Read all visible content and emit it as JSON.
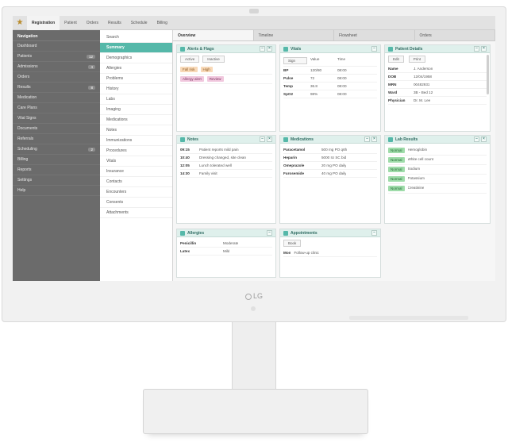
{
  "monitor": {
    "brand": "LG"
  },
  "topbar": {
    "tabs": [
      "Registration",
      "Patient",
      "Orders",
      "Results",
      "Schedule",
      "Billing"
    ]
  },
  "leftnav": {
    "header": "Navigation",
    "items": [
      {
        "label": "Dashboard",
        "badge": ""
      },
      {
        "label": "Patients",
        "badge": "12"
      },
      {
        "label": "Admissions",
        "badge": "4"
      },
      {
        "label": "Orders",
        "badge": ""
      },
      {
        "label": "Results",
        "badge": "8"
      },
      {
        "label": "Medication",
        "badge": ""
      },
      {
        "label": "Care Plans",
        "badge": ""
      },
      {
        "label": "Vital Signs",
        "badge": ""
      },
      {
        "label": "Documents",
        "badge": ""
      },
      {
        "label": "Referrals",
        "badge": ""
      },
      {
        "label": "Scheduling",
        "badge": "2"
      },
      {
        "label": "Billing",
        "badge": ""
      },
      {
        "label": "Reports",
        "badge": ""
      },
      {
        "label": "Settings",
        "badge": ""
      },
      {
        "label": "Help",
        "badge": ""
      }
    ]
  },
  "sublist": {
    "items": [
      {
        "label": "Search",
        "active": false
      },
      {
        "label": "Summary",
        "active": true
      },
      {
        "label": "Demographics",
        "active": false
      },
      {
        "label": "Allergies",
        "active": false
      },
      {
        "label": "Problems",
        "active": false
      },
      {
        "label": "History",
        "active": false
      },
      {
        "label": "Labs",
        "active": false
      },
      {
        "label": "Imaging",
        "active": false
      },
      {
        "label": "Medications",
        "active": false
      },
      {
        "label": "Notes",
        "active": false
      },
      {
        "label": "Immunizations",
        "active": false
      },
      {
        "label": "Procedures",
        "active": false
      },
      {
        "label": "Vitals",
        "active": false
      },
      {
        "label": "Insurance",
        "active": false
      },
      {
        "label": "Contacts",
        "active": false
      },
      {
        "label": "Encounters",
        "active": false
      },
      {
        "label": "Consents",
        "active": false
      },
      {
        "label": "Attachments",
        "active": false
      }
    ]
  },
  "main": {
    "tabs": [
      "Overview",
      "Timeline",
      "Flowsheet",
      "Orders"
    ],
    "panels": {
      "alerts": {
        "title": "Alerts & Flags",
        "buttons": [
          "Active",
          "Inactive"
        ],
        "rows": [
          {
            "name": "Fall risk",
            "status": "High"
          },
          {
            "name": "Allergy alert",
            "status": "Review"
          }
        ]
      },
      "vitals": {
        "title": "Vitals",
        "headers": [
          "Sign",
          "Value",
          "Time"
        ],
        "rows": [
          {
            "sign": "BP",
            "value": "120/80",
            "time": "08:00"
          },
          {
            "sign": "Pulse",
            "value": "72",
            "time": "08:00"
          },
          {
            "sign": "Temp",
            "value": "36.8",
            "time": "08:00"
          },
          {
            "sign": "SpO2",
            "value": "98%",
            "time": "08:00"
          }
        ]
      },
      "patient": {
        "title": "Patient Details",
        "buttons": [
          "Edit",
          "Print"
        ],
        "rows": [
          {
            "label": "Name",
            "value": "J. Anderson"
          },
          {
            "label": "DOB",
            "value": "12/04/1958"
          },
          {
            "label": "MRN",
            "value": "00482931"
          },
          {
            "label": "Ward",
            "value": "3B - Bed 12"
          },
          {
            "label": "Physician",
            "value": "Dr. M. Lee"
          }
        ]
      },
      "notes": {
        "title": "Notes",
        "rows": [
          {
            "time": "09:15",
            "text": "Patient reports mild pain"
          },
          {
            "time": "10:40",
            "text": "Dressing changed, site clean"
          },
          {
            "time": "12:05",
            "text": "Lunch tolerated well"
          },
          {
            "time": "14:30",
            "text": "Family visit"
          }
        ]
      },
      "medications": {
        "title": "Medications",
        "rows": [
          {
            "name": "Paracetamol",
            "dose": "500 mg PO q6h"
          },
          {
            "name": "Heparin",
            "dose": "5000 IU SC bid"
          },
          {
            "name": "Omeprazole",
            "dose": "20 mg PO daily"
          },
          {
            "name": "Furosemide",
            "dose": "40 mg PO daily"
          }
        ]
      },
      "results": {
        "title": "Lab Results",
        "rows": [
          {
            "flag": "Normal",
            "test": "Hemoglobin"
          },
          {
            "flag": "Normal",
            "test": "White cell count"
          },
          {
            "flag": "Normal",
            "test": "Sodium"
          },
          {
            "flag": "Normal",
            "test": "Potassium"
          },
          {
            "flag": "Normal",
            "test": "Creatinine"
          }
        ]
      },
      "allergies": {
        "title": "Allergies",
        "rows": [
          {
            "name": "Penicillin",
            "severity": "Moderate"
          },
          {
            "name": "Latex",
            "severity": "Mild"
          }
        ]
      },
      "appointments": {
        "title": "Appointments",
        "buttons": [
          "Book"
        ],
        "rows": [
          {
            "date": "Mon",
            "desc": "Follow-up clinic"
          }
        ]
      }
    }
  }
}
